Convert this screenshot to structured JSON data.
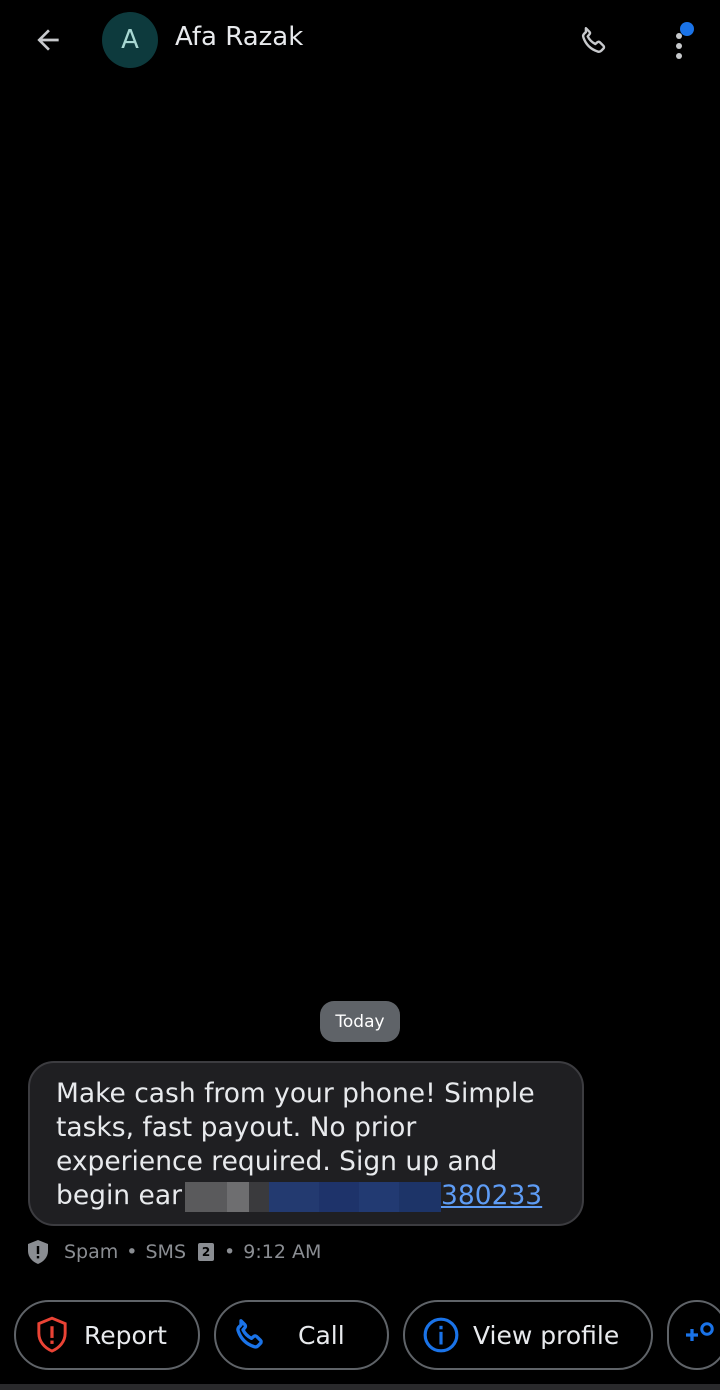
{
  "header": {
    "contact_initial": "A",
    "contact_name": "Afa Razak"
  },
  "conversation": {
    "date_chip": "Today",
    "message": {
      "text_lines": "Make cash from your phone! Simple\ntasks, fast payout. No prior\nexperience required. Sign up and\nbegin ear",
      "link_tail": "380233"
    },
    "meta": {
      "label_spam": "Spam",
      "sep1": "•",
      "label_sms": "SMS",
      "sim_number": "2",
      "sep2": "•",
      "time": "9:12 AM"
    }
  },
  "actions": [
    {
      "label": "Report",
      "icon": "shield-alert-icon",
      "color": "#ea4335"
    },
    {
      "label": "Call",
      "icon": "phone-icon",
      "color": "#1a73e8"
    },
    {
      "label": "View profile",
      "icon": "info-icon",
      "color": "#1a73e8"
    }
  ],
  "colors": {
    "accent_blue": "#1a73e8",
    "report_red": "#ea4335",
    "avatar_bg": "#0d3a3d"
  }
}
